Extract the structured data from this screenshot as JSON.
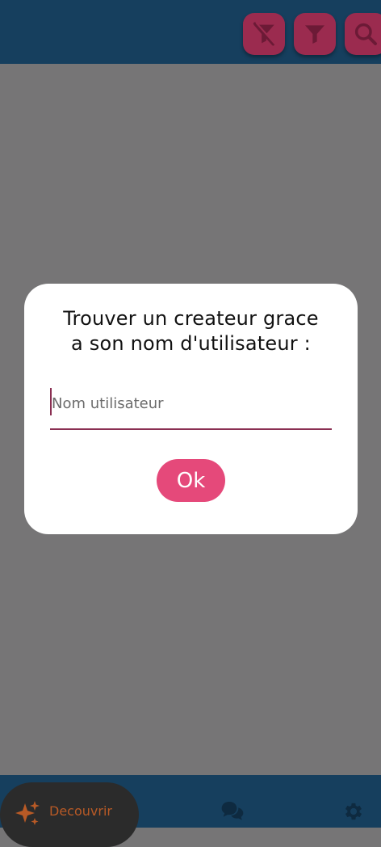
{
  "toolbar": {
    "buttons": [
      {
        "name": "clear-filter",
        "icon": "filter-off-icon"
      },
      {
        "name": "filter",
        "icon": "filter-icon"
      },
      {
        "name": "search",
        "icon": "search-icon"
      }
    ],
    "button_color": "#9b2b4f",
    "bar_color": "#163f5e"
  },
  "dialog": {
    "title_line1": "Trouver un createur grace",
    "title_line2": "a son nom d'utilisateur :",
    "input_placeholder": "Nom utilisateur",
    "input_value": "",
    "ok_label": "Ok",
    "ok_color": "#e5497a"
  },
  "bottom_nav": {
    "items": [
      {
        "label": "Decouvrir",
        "icon": "sparkles-icon",
        "active": true
      },
      {
        "icon": "chat-icon",
        "active": false
      },
      {
        "icon": "gear-icon",
        "active": false
      }
    ],
    "active_color": "#b85a26"
  }
}
